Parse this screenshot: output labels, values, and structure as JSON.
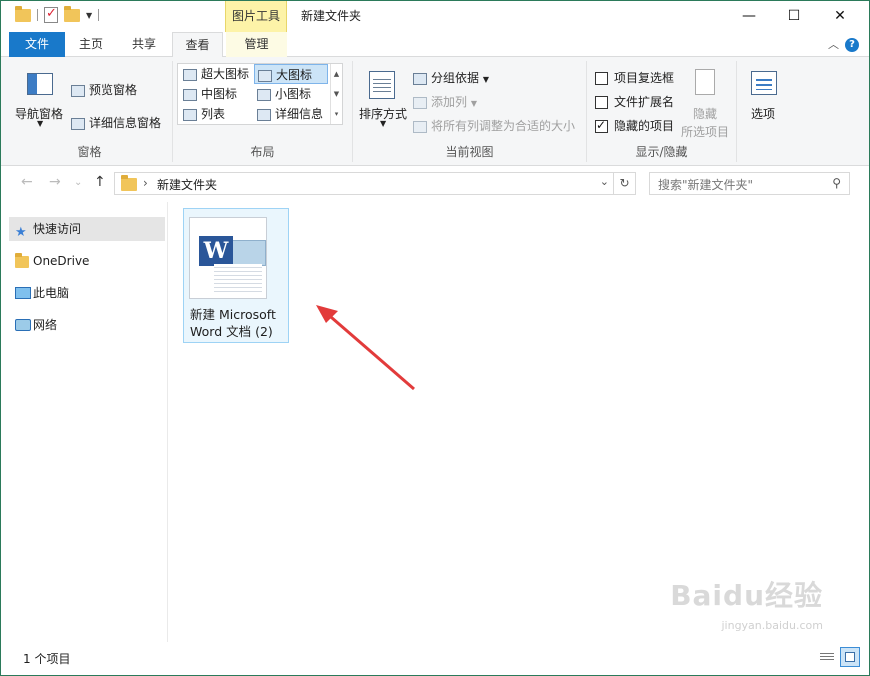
{
  "window": {
    "title": "新建文件夹",
    "context_tab": "图片工具",
    "accent": "#1979ca"
  },
  "tabs": {
    "file": "文件",
    "home": "主页",
    "share": "共享",
    "view": "查看",
    "manage": "管理"
  },
  "ribbon": {
    "panes": {
      "label": "窗格",
      "nav_pane": "导航窗格",
      "preview_pane": "预览窗格",
      "details_pane": "详细信息窗格"
    },
    "layout": {
      "label": "布局",
      "extra_large": "超大图标",
      "large": "大图标",
      "medium": "中图标",
      "small": "小图标",
      "list": "列表",
      "details": "详细信息",
      "selected": "大图标"
    },
    "current_view": {
      "label": "当前视图",
      "sort_by": "排序方式",
      "group_by": "分组依据",
      "add_columns": "添加列",
      "size_all": "将所有列调整为合适的大小"
    },
    "show_hide": {
      "label": "显示/隐藏",
      "item_checkboxes": "项目复选框",
      "file_extensions": "文件扩展名",
      "hidden_items": "隐藏的项目",
      "hidden_items_checked": true,
      "hide": "隐藏",
      "selected_items": "所选项目"
    },
    "options": "选项"
  },
  "address": {
    "path": "新建文件夹",
    "search_placeholder": "搜索\"新建文件夹\""
  },
  "sidebar": {
    "items": [
      {
        "label": "快速访问",
        "icon": "star-icon"
      },
      {
        "label": "OneDrive",
        "icon": "folder-icon"
      },
      {
        "label": "此电脑",
        "icon": "computer-icon"
      },
      {
        "label": "网络",
        "icon": "network-icon"
      }
    ]
  },
  "content": {
    "files": [
      {
        "name": "新建 Microsoft Word 文档 (2)",
        "icon": "word-document-icon"
      }
    ]
  },
  "status": {
    "item_count": "1 个项目"
  },
  "watermark": {
    "brand": "Baidu经验",
    "url": "jingyan.baidu.com"
  }
}
